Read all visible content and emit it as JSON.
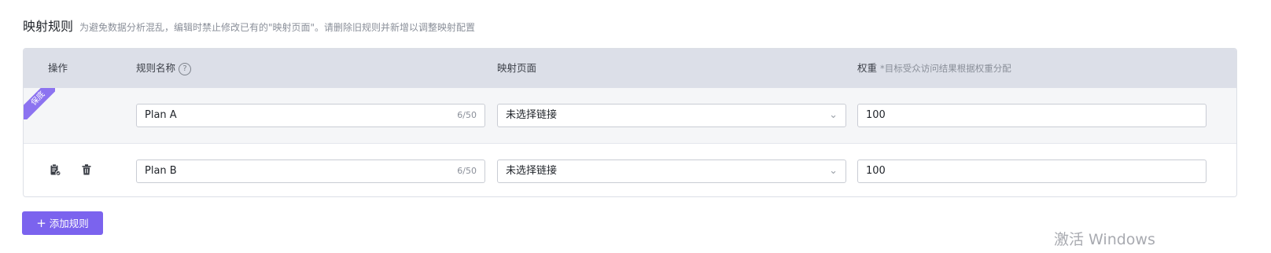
{
  "section": {
    "title": "映射规则",
    "hint": "为避免数据分析混乱，编辑时禁止修改已有的\"映射页面\"。请删除旧规则并新增以调整映射配置"
  },
  "table": {
    "headers": {
      "action": "操作",
      "rule_name": "规则名称",
      "page": "映射页面",
      "weight": "权重",
      "weight_hint": "*目标受众访问结果根据权重分配"
    },
    "rows": [
      {
        "badge": "保底",
        "name": "Plan A",
        "name_count": "6/50",
        "page": "未选择链接",
        "weight": "100"
      },
      {
        "name": "Plan B",
        "name_count": "6/50",
        "page": "未选择链接",
        "weight": "100"
      }
    ]
  },
  "buttons": {
    "add_rule": "添加规则"
  },
  "watermark": "激活 Windows",
  "colors": {
    "accent": "#7b63ee",
    "header_bg": "#dcdfe8",
    "row_bg": "#f5f6f8"
  }
}
